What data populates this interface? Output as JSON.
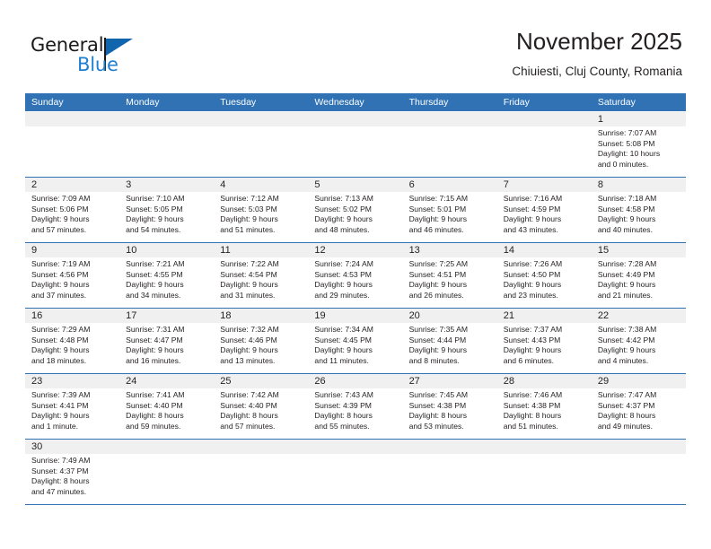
{
  "brand": {
    "name_top": "General",
    "name_bottom": "Blue",
    "accent_color": "#1f7fd0",
    "flag_color": "#1165ad"
  },
  "header": {
    "title": "November 2025",
    "subtitle": "Chiuiesti, Cluj County, Romania",
    "header_bg_color": "#3072b4",
    "daynum_bg_color": "#f0f0f0"
  },
  "weekdays": [
    "Sunday",
    "Monday",
    "Tuesday",
    "Wednesday",
    "Thursday",
    "Friday",
    "Saturday"
  ],
  "weeks": [
    [
      {
        "day": "",
        "blank": true
      },
      {
        "day": "",
        "blank": true
      },
      {
        "day": "",
        "blank": true
      },
      {
        "day": "",
        "blank": true
      },
      {
        "day": "",
        "blank": true
      },
      {
        "day": "",
        "blank": true
      },
      {
        "day": "1",
        "sunrise": "Sunrise: 7:07 AM",
        "sunset": "Sunset: 5:08 PM",
        "daylight1": "Daylight: 10 hours",
        "daylight2": "and 0 minutes."
      }
    ],
    [
      {
        "day": "2",
        "sunrise": "Sunrise: 7:09 AM",
        "sunset": "Sunset: 5:06 PM",
        "daylight1": "Daylight: 9 hours",
        "daylight2": "and 57 minutes."
      },
      {
        "day": "3",
        "sunrise": "Sunrise: 7:10 AM",
        "sunset": "Sunset: 5:05 PM",
        "daylight1": "Daylight: 9 hours",
        "daylight2": "and 54 minutes."
      },
      {
        "day": "4",
        "sunrise": "Sunrise: 7:12 AM",
        "sunset": "Sunset: 5:03 PM",
        "daylight1": "Daylight: 9 hours",
        "daylight2": "and 51 minutes."
      },
      {
        "day": "5",
        "sunrise": "Sunrise: 7:13 AM",
        "sunset": "Sunset: 5:02 PM",
        "daylight1": "Daylight: 9 hours",
        "daylight2": "and 48 minutes."
      },
      {
        "day": "6",
        "sunrise": "Sunrise: 7:15 AM",
        "sunset": "Sunset: 5:01 PM",
        "daylight1": "Daylight: 9 hours",
        "daylight2": "and 46 minutes."
      },
      {
        "day": "7",
        "sunrise": "Sunrise: 7:16 AM",
        "sunset": "Sunset: 4:59 PM",
        "daylight1": "Daylight: 9 hours",
        "daylight2": "and 43 minutes."
      },
      {
        "day": "8",
        "sunrise": "Sunrise: 7:18 AM",
        "sunset": "Sunset: 4:58 PM",
        "daylight1": "Daylight: 9 hours",
        "daylight2": "and 40 minutes."
      }
    ],
    [
      {
        "day": "9",
        "sunrise": "Sunrise: 7:19 AM",
        "sunset": "Sunset: 4:56 PM",
        "daylight1": "Daylight: 9 hours",
        "daylight2": "and 37 minutes."
      },
      {
        "day": "10",
        "sunrise": "Sunrise: 7:21 AM",
        "sunset": "Sunset: 4:55 PM",
        "daylight1": "Daylight: 9 hours",
        "daylight2": "and 34 minutes."
      },
      {
        "day": "11",
        "sunrise": "Sunrise: 7:22 AM",
        "sunset": "Sunset: 4:54 PM",
        "daylight1": "Daylight: 9 hours",
        "daylight2": "and 31 minutes."
      },
      {
        "day": "12",
        "sunrise": "Sunrise: 7:24 AM",
        "sunset": "Sunset: 4:53 PM",
        "daylight1": "Daylight: 9 hours",
        "daylight2": "and 29 minutes."
      },
      {
        "day": "13",
        "sunrise": "Sunrise: 7:25 AM",
        "sunset": "Sunset: 4:51 PM",
        "daylight1": "Daylight: 9 hours",
        "daylight2": "and 26 minutes."
      },
      {
        "day": "14",
        "sunrise": "Sunrise: 7:26 AM",
        "sunset": "Sunset: 4:50 PM",
        "daylight1": "Daylight: 9 hours",
        "daylight2": "and 23 minutes."
      },
      {
        "day": "15",
        "sunrise": "Sunrise: 7:28 AM",
        "sunset": "Sunset: 4:49 PM",
        "daylight1": "Daylight: 9 hours",
        "daylight2": "and 21 minutes."
      }
    ],
    [
      {
        "day": "16",
        "sunrise": "Sunrise: 7:29 AM",
        "sunset": "Sunset: 4:48 PM",
        "daylight1": "Daylight: 9 hours",
        "daylight2": "and 18 minutes."
      },
      {
        "day": "17",
        "sunrise": "Sunrise: 7:31 AM",
        "sunset": "Sunset: 4:47 PM",
        "daylight1": "Daylight: 9 hours",
        "daylight2": "and 16 minutes."
      },
      {
        "day": "18",
        "sunrise": "Sunrise: 7:32 AM",
        "sunset": "Sunset: 4:46 PM",
        "daylight1": "Daylight: 9 hours",
        "daylight2": "and 13 minutes."
      },
      {
        "day": "19",
        "sunrise": "Sunrise: 7:34 AM",
        "sunset": "Sunset: 4:45 PM",
        "daylight1": "Daylight: 9 hours",
        "daylight2": "and 11 minutes."
      },
      {
        "day": "20",
        "sunrise": "Sunrise: 7:35 AM",
        "sunset": "Sunset: 4:44 PM",
        "daylight1": "Daylight: 9 hours",
        "daylight2": "and 8 minutes."
      },
      {
        "day": "21",
        "sunrise": "Sunrise: 7:37 AM",
        "sunset": "Sunset: 4:43 PM",
        "daylight1": "Daylight: 9 hours",
        "daylight2": "and 6 minutes."
      },
      {
        "day": "22",
        "sunrise": "Sunrise: 7:38 AM",
        "sunset": "Sunset: 4:42 PM",
        "daylight1": "Daylight: 9 hours",
        "daylight2": "and 4 minutes."
      }
    ],
    [
      {
        "day": "23",
        "sunrise": "Sunrise: 7:39 AM",
        "sunset": "Sunset: 4:41 PM",
        "daylight1": "Daylight: 9 hours",
        "daylight2": "and 1 minute."
      },
      {
        "day": "24",
        "sunrise": "Sunrise: 7:41 AM",
        "sunset": "Sunset: 4:40 PM",
        "daylight1": "Daylight: 8 hours",
        "daylight2": "and 59 minutes."
      },
      {
        "day": "25",
        "sunrise": "Sunrise: 7:42 AM",
        "sunset": "Sunset: 4:40 PM",
        "daylight1": "Daylight: 8 hours",
        "daylight2": "and 57 minutes."
      },
      {
        "day": "26",
        "sunrise": "Sunrise: 7:43 AM",
        "sunset": "Sunset: 4:39 PM",
        "daylight1": "Daylight: 8 hours",
        "daylight2": "and 55 minutes."
      },
      {
        "day": "27",
        "sunrise": "Sunrise: 7:45 AM",
        "sunset": "Sunset: 4:38 PM",
        "daylight1": "Daylight: 8 hours",
        "daylight2": "and 53 minutes."
      },
      {
        "day": "28",
        "sunrise": "Sunrise: 7:46 AM",
        "sunset": "Sunset: 4:38 PM",
        "daylight1": "Daylight: 8 hours",
        "daylight2": "and 51 minutes."
      },
      {
        "day": "29",
        "sunrise": "Sunrise: 7:47 AM",
        "sunset": "Sunset: 4:37 PM",
        "daylight1": "Daylight: 8 hours",
        "daylight2": "and 49 minutes."
      }
    ],
    [
      {
        "day": "30",
        "sunrise": "Sunrise: 7:49 AM",
        "sunset": "Sunset: 4:37 PM",
        "daylight1": "Daylight: 8 hours",
        "daylight2": "and 47 minutes."
      },
      {
        "day": "",
        "blank": true
      },
      {
        "day": "",
        "blank": true
      },
      {
        "day": "",
        "blank": true
      },
      {
        "day": "",
        "blank": true
      },
      {
        "day": "",
        "blank": true
      },
      {
        "day": "",
        "blank": true
      }
    ]
  ]
}
